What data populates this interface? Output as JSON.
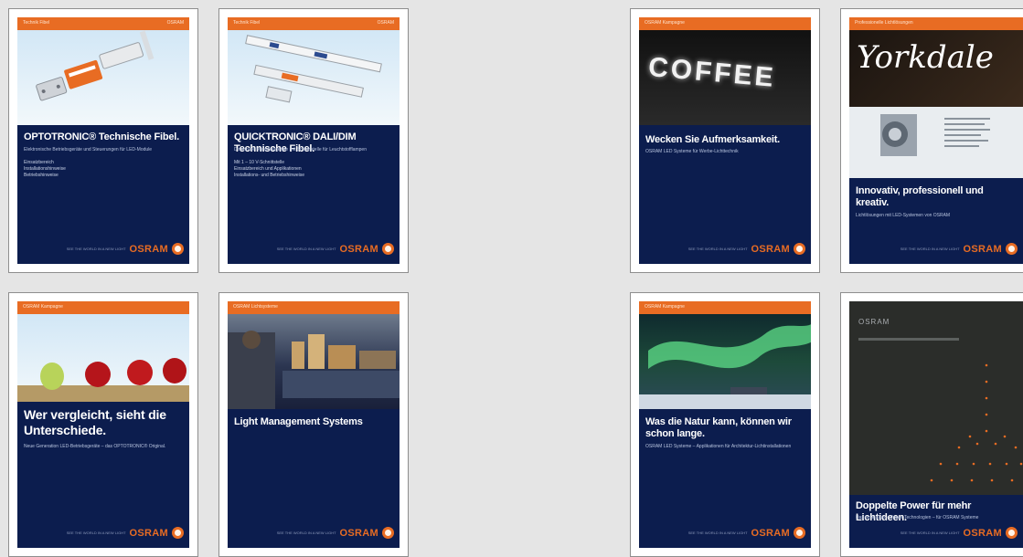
{
  "brand": {
    "name": "OSRAM",
    "tagline": "SEE THE WORLD IN A NEW LIGHT"
  },
  "cards": [
    {
      "bar_left": "Technik Fibel",
      "bar_right": "OSRAM",
      "title": "OPTOTRONIC® Technische Fibel.",
      "subtitle": "Elektronische Betriebsgeräte und Steuerungen für LED-Module",
      "bullets": [
        "Einsatzbereich",
        "Installationshinweise",
        "Betriebshinweise"
      ]
    },
    {
      "bar_left": "Technik Fibel",
      "bar_right": "OSRAM",
      "title": "QUICKTRONIC® DALI/DIM Technische Fibel.",
      "subtitle": "Dimmbare Vorschaltgeräte mit Schnittstelle für Leuchtstofflampen",
      "bullets": [
        "Mit 1 – 10 V-Schnittstelle",
        "Einsatzbereich und Applikationen",
        "Installations- und Betriebshinweise"
      ]
    },
    {
      "bar_left": "OSRAM Kampagne",
      "title": "Wecken Sie Aufmerksamkeit.",
      "subtitle": "OSRAM LED Systeme für Werbe-Lichttechnik",
      "hero_text": "COFFEE"
    },
    {
      "bar_left": "Professionelle Lichtlösungen",
      "title": "Innovativ, professionell und kreativ.",
      "subtitle": "Lichtlösungen mit LED-Systemen von OSRAM",
      "hero_text": "Yorkdale"
    },
    {
      "bar_left": "OSRAM Kampagne",
      "title": "Wer vergleicht, sieht die Unterschiede.",
      "subtitle": "Neue Generation LED-Betriebsgeräte – das OPTOTRONIC® Original."
    },
    {
      "bar_left": "OSRAM Lichtsysteme",
      "title": "Light Management Systems"
    },
    {
      "bar_left": "OSRAM Kampagne",
      "title": "Was die Natur kann, können wir schon lange.",
      "subtitle": "OSRAM LED Systeme – Applikationen für Architektur-Lichtinstallationen"
    },
    {
      "top_text": "OSRAM",
      "title": "Doppelte Power für mehr Lichtideen.",
      "subtitle": "Das neue Duo – Power Technologien – für OSRAM Systeme"
    }
  ]
}
